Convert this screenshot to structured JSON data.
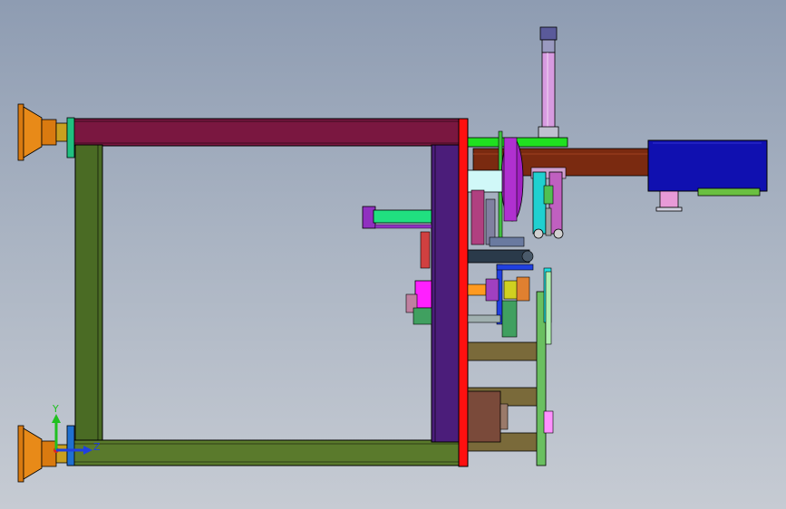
{
  "viewport": {
    "background_top": "#8e9cb2",
    "background_bottom": "#c6cbd3"
  },
  "triad": {
    "y_label": "Y",
    "z_label": "Z",
    "x_color": "#e02020",
    "y_color": "#20c020",
    "z_color": "#2040e0"
  },
  "colors": {
    "frame_top": "#7a1740",
    "frame_side": "#4a6b24",
    "frame_bottom": "#5a7a2c",
    "purple_plate": "#4b1d7a",
    "red_plate": "#ff1010",
    "feet": "#d97a10",
    "cylinder": "#d79be0",
    "shaft": "#7a2a10",
    "motor_box": "#1010b0",
    "rods": "#7a6a3a",
    "green_plate": "#6ac060",
    "magenta": "#ff20ff",
    "cyan": "#20e0e0"
  }
}
